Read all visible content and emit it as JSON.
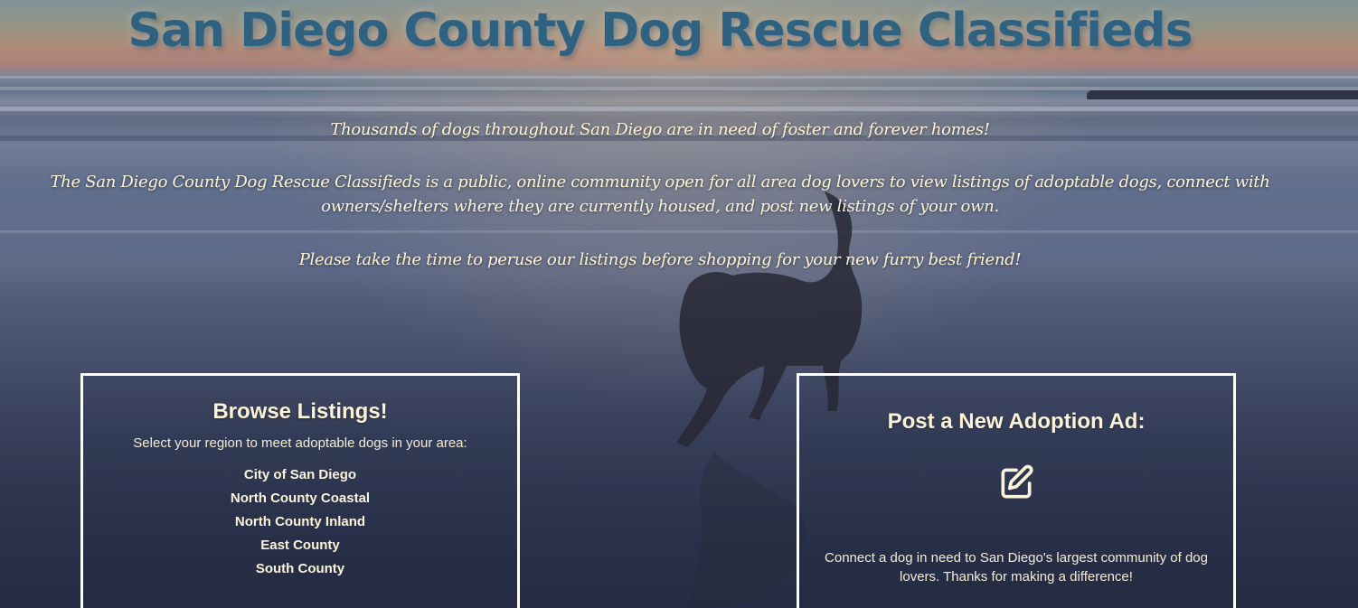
{
  "header": {
    "title": "San Diego County Dog Rescue Classifieds"
  },
  "intro": {
    "line1": "Thousands of dogs throughout San Diego are in need of foster and forever homes!",
    "line2": "The San Diego County Dog Rescue Classifieds is a public, online community open for all area dog lovers to view listings of adoptable dogs, connect with owners/shelters where they are currently housed, and post new listings of your own.",
    "line3": "Please take the time to peruse our listings before shopping for your new furry best friend!"
  },
  "browse": {
    "heading": "Browse Listings!",
    "subtitle": "Select your region to meet adoptable dogs in your area:",
    "regions": [
      "City of San Diego",
      "North County Coastal",
      "North County Inland",
      "East County",
      "South County"
    ]
  },
  "post": {
    "heading": "Post a New Adoption Ad:",
    "icon": "edit-icon",
    "description": "Connect a dog in need to San Diego's largest community of dog lovers. Thanks for making a difference!"
  },
  "colors": {
    "title": "#2f6180",
    "text": "#fbf4d8",
    "card_border": "#ffffff"
  }
}
